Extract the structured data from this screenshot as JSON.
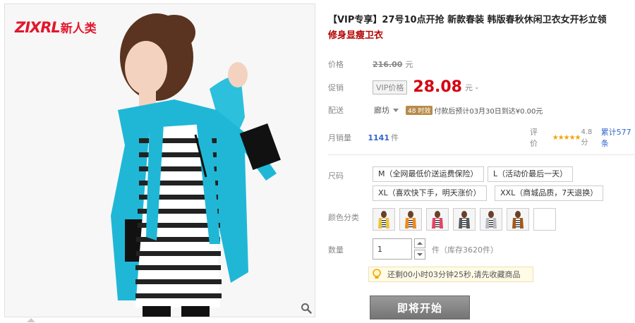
{
  "brand": {
    "latin": "ZIXRL",
    "cn": "新人类"
  },
  "title": {
    "line1": "【VIP专享】27号10点开抢 新款春装 韩版春秋休闲卫衣女开衫立领",
    "line2": "修身显瘦卫衣"
  },
  "price": {
    "label": "价格",
    "original": "216.00",
    "unit": "元"
  },
  "promo": {
    "label": "促销",
    "vip_badge": "VIP价格",
    "price": "28.08",
    "unit": "元",
    "chevron": "⌄"
  },
  "shipping": {
    "label": "配送",
    "location": "廊坊",
    "badge": "48 时效",
    "text": "付款后预计03月30日到达¥0.00元"
  },
  "sales": {
    "label": "月销量",
    "count": "1141",
    "unit": "件",
    "rating_label": "评价",
    "stars": "★★★★★",
    "score": "4.8分",
    "total": "累计577条"
  },
  "size": {
    "label": "尺码",
    "options": [
      "M（全网最低价送运费保险）",
      "L（活动价最后一天）",
      "XL（喜欢快下手，明天涨价）",
      "XXL（商城品质，7天退换）"
    ]
  },
  "color": {
    "label": "颜色分类",
    "swatches": [
      "#e8c53a",
      "#f08a1c",
      "#e5456a",
      "#555a60",
      "#b8bcc2",
      "#a05a22",
      "#ffffff"
    ]
  },
  "quantity": {
    "label": "数量",
    "value": "1",
    "stock": "件（库存3620件）"
  },
  "countdown": {
    "text": "还剩00小时03分钟25秒,请先收藏商品"
  },
  "start_button": "即将开始",
  "icons": {
    "zoom": "magnifier-icon",
    "bulb": "lightbulb-icon"
  }
}
